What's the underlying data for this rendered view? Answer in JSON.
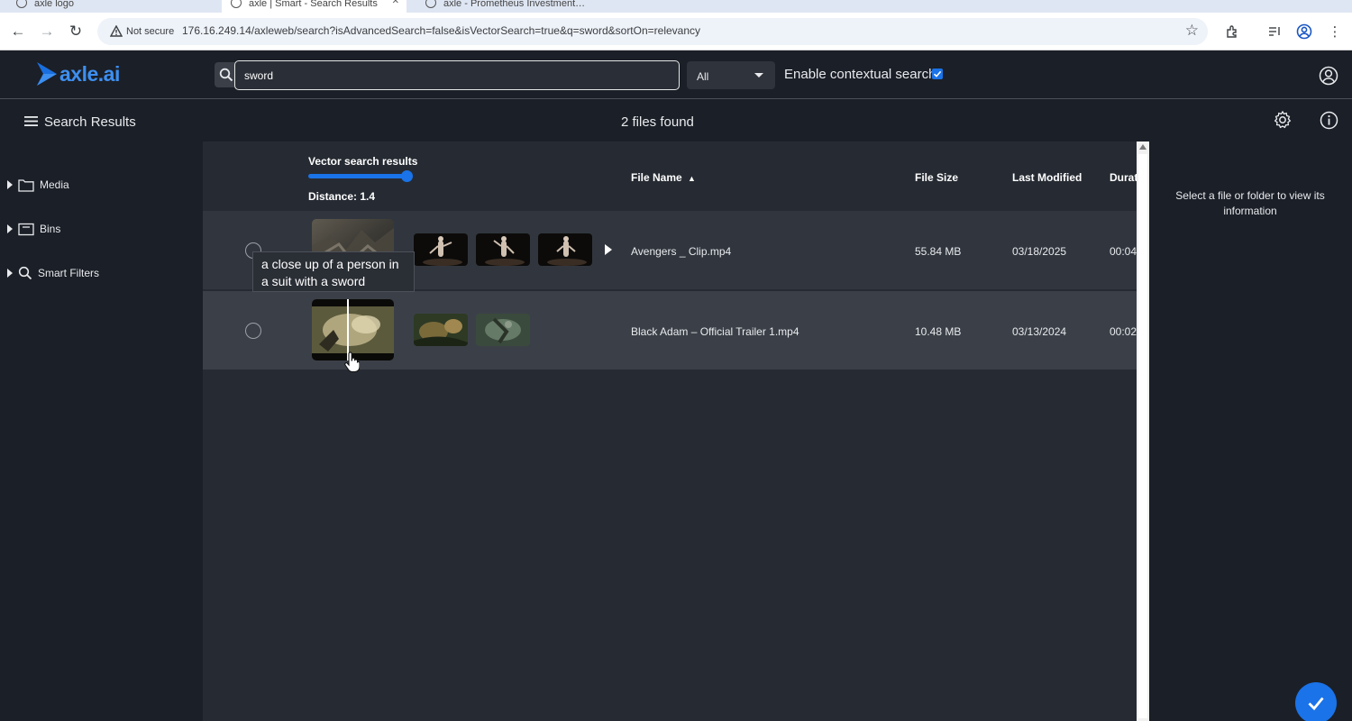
{
  "browser": {
    "tabs": [
      {
        "label": "axle logo",
        "active": false
      },
      {
        "label": "axle | Smart - Search Results",
        "active": true
      },
      {
        "label": "axle - Prometheus Investment…",
        "active": false
      }
    ],
    "security_label": "Not secure",
    "url": "176.16.249.14/axleweb/search?isAdvancedSearch=false&isVectorSearch=true&q=sword&sortOn=relevancy"
  },
  "header": {
    "logo_text": "axle.ai",
    "search_value": "sword",
    "scope_selected": "All",
    "contextual_label": "Enable contextual search",
    "contextual_checked": true
  },
  "subheader": {
    "title": "Search Results",
    "files_found": "2 files found"
  },
  "sidebar": {
    "items": [
      {
        "label": "Media",
        "icon": "folder-icon"
      },
      {
        "label": "Bins",
        "icon": "bin-icon"
      },
      {
        "label": "Smart Filters",
        "icon": "search-icon"
      }
    ]
  },
  "table": {
    "vector_label": "Vector search results",
    "distance_label": "Distance: 1.4",
    "distance_value": 1.4,
    "columns": {
      "name": "File Name",
      "size": "File Size",
      "modified": "Last Modified",
      "duration": "Durat"
    },
    "rows": [
      {
        "name": "Avengers _ Clip.mp4",
        "size": "55.84 MB",
        "modified": "03/18/2025",
        "duration": "00:04"
      },
      {
        "name": "Black Adam – Official Trailer 1.mp4",
        "size": "10.48 MB",
        "modified": "03/13/2024",
        "duration": "00:02"
      }
    ]
  },
  "tooltip": "a close up of a person in a suit with a sword",
  "right_panel": {
    "message": "Select a file or folder to view its information"
  },
  "colors": {
    "accent": "#1a73e8",
    "logo": "#3d8ff0",
    "background": "#1b1f27",
    "main_bg": "#262b33"
  }
}
